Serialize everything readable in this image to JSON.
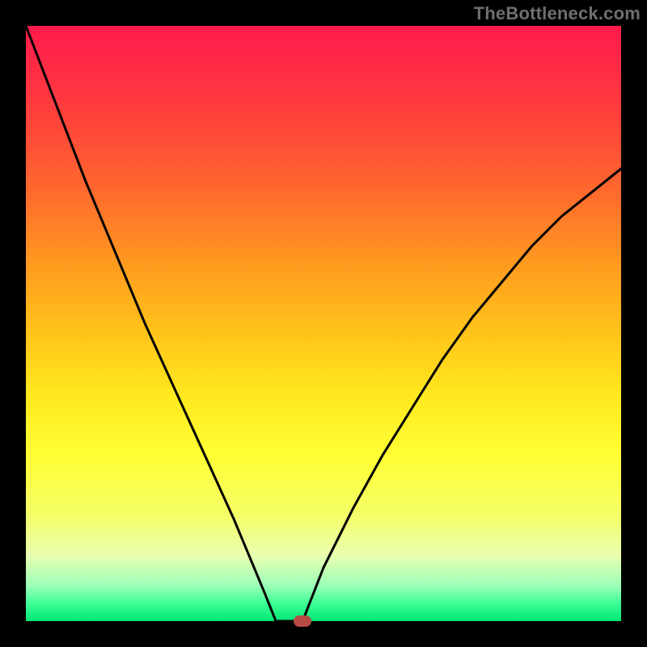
{
  "attribution": "TheBottleneck.com",
  "chart_data": {
    "type": "line",
    "title": "",
    "xlabel": "",
    "ylabel": "",
    "xlim": [
      0,
      100
    ],
    "ylim": [
      0,
      100
    ],
    "series": [
      {
        "name": "curve-left",
        "x": [
          0,
          5,
          10,
          15,
          20,
          25,
          30,
          35,
          40,
          42
        ],
        "values": [
          100,
          87,
          74,
          62,
          50,
          39,
          28,
          17,
          5,
          0
        ]
      },
      {
        "name": "curve-flat",
        "x": [
          42,
          46.5
        ],
        "values": [
          0,
          0
        ]
      },
      {
        "name": "curve-right",
        "x": [
          46.5,
          50,
          55,
          60,
          65,
          70,
          75,
          80,
          85,
          90,
          95,
          100
        ],
        "values": [
          0,
          9,
          19,
          28,
          36,
          44,
          51,
          57,
          63,
          68,
          72,
          76
        ]
      }
    ],
    "marker": {
      "x": 46.5,
      "y": 0,
      "color": "#b74a42"
    },
    "gradient_stops": [
      {
        "pos": 0,
        "color": "#ff1a4d"
      },
      {
        "pos": 14,
        "color": "#ff3d3d"
      },
      {
        "pos": 28,
        "color": "#ff6a2d"
      },
      {
        "pos": 40,
        "color": "#ff9a1f"
      },
      {
        "pos": 52,
        "color": "#ffc51a"
      },
      {
        "pos": 62,
        "color": "#ffe81f"
      },
      {
        "pos": 72,
        "color": "#ffff33"
      },
      {
        "pos": 82,
        "color": "#f5ff66"
      },
      {
        "pos": 89,
        "color": "#e9ffb0"
      },
      {
        "pos": 94,
        "color": "#9cffb8"
      },
      {
        "pos": 97,
        "color": "#3fff95"
      },
      {
        "pos": 100,
        "color": "#00e676"
      }
    ]
  }
}
